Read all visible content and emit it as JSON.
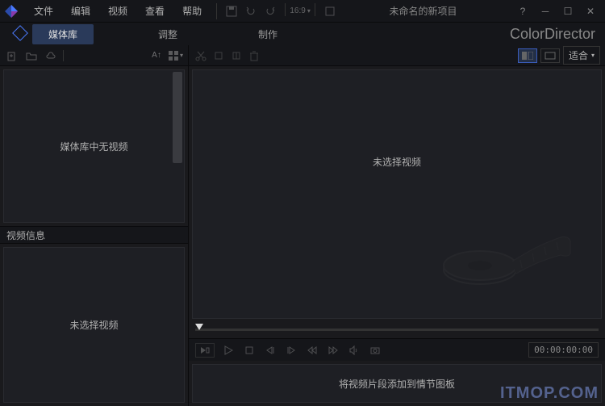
{
  "menu": {
    "file": "文件",
    "edit": "编辑",
    "video": "视频",
    "view": "查看",
    "help": "帮助"
  },
  "aspect_ratio": "16:9",
  "project_title": "未命名的新项目",
  "brand": "ColorDirector",
  "tabs": {
    "media": "媒体库",
    "adjust": "调整",
    "produce": "制作"
  },
  "left_toolbar": {
    "sort": "A↑",
    "view": "▦"
  },
  "media_empty": "媒体库中无视频",
  "video_info_header": "视频信息",
  "video_info_empty": "未选择视频",
  "preview_empty": "未选择视频",
  "fit_dropdown": "适合",
  "timecode": "00:00:00:00",
  "storyboard_hint": "将视频片段添加到情节图板",
  "watermark": "ITMOP.COM"
}
